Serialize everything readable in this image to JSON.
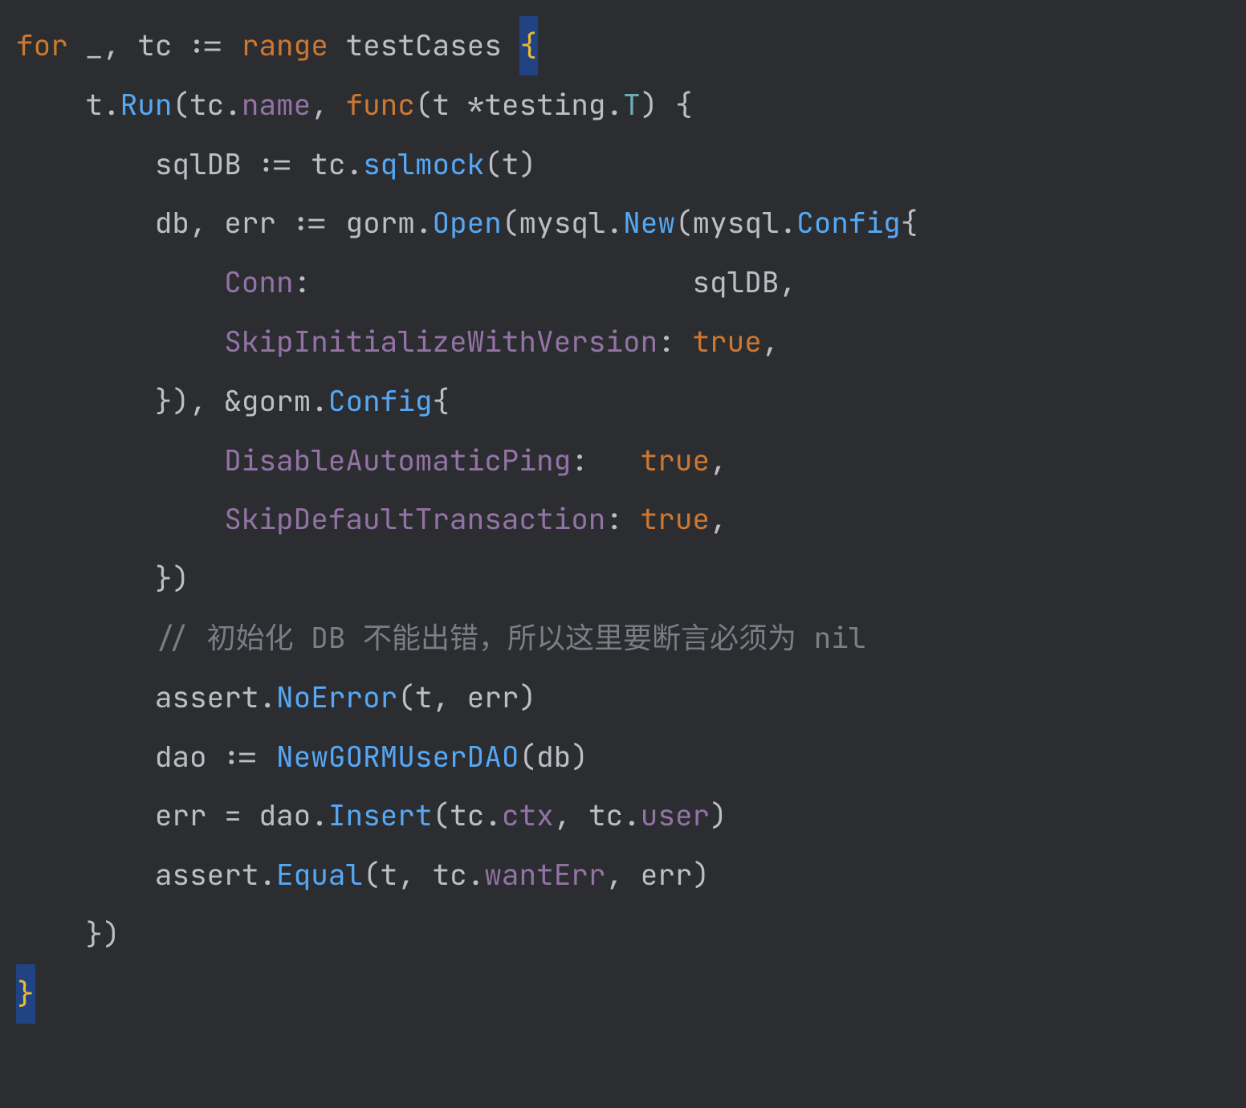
{
  "code": {
    "l1": {
      "kw_for": "for",
      "blank": "_",
      "tc": "tc",
      "assign": ":=",
      "kw_range": "range",
      "testCases": "testCases",
      "lbr": "{"
    },
    "l2": {
      "t": "t",
      "Run": "Run",
      "lp": "(",
      "tc": "tc",
      "dot": ".",
      "name": "name",
      "comma": ",",
      "kw_func": "func",
      "lp2": "(",
      "t2": "t",
      "star": "*",
      "testing": "testing",
      "dot2": ".",
      "T": "T",
      "rp": ")",
      "lbr": "{"
    },
    "l3": {
      "sqlDB": "sqlDB",
      "assign": ":=",
      "tc": "tc",
      "dot": ".",
      "sqlmock": "sqlmock",
      "lp": "(",
      "t": "t",
      "rp": ")"
    },
    "l4": {
      "db": "db",
      "comma": ",",
      "err": "err",
      "assign": ":=",
      "gorm": "gorm",
      "dot": ".",
      "Open": "Open",
      "lp": "(",
      "mysql": "mysql",
      "dot2": ".",
      "New": "New",
      "lp2": "(",
      "mysql2": "mysql",
      "dot3": ".",
      "Config": "Config",
      "lbr": "{"
    },
    "l5": {
      "Conn": "Conn",
      "colon": ":",
      "sqlDB": "sqlDB",
      "comma": ","
    },
    "l6": {
      "Skip": "SkipInitializeWithVersion",
      "colon": ":",
      "true": "true",
      "comma": ","
    },
    "l7": {
      "rbrace": "}",
      "rp": ")",
      "comma": ",",
      "amp": "&",
      "gorm": "gorm",
      "dot": ".",
      "Config": "Config",
      "lbr": "{"
    },
    "l8": {
      "DisableAutomaticPing": "DisableAutomaticPing",
      "colon": ":",
      "true": "true",
      "comma": ","
    },
    "l9": {
      "SkipDefaultTransaction": "SkipDefaultTransaction",
      "colon": ":",
      "true": "true",
      "comma": ","
    },
    "l10": {
      "rbrace": "}",
      "rp": ")"
    },
    "l11": {
      "comment": "// 初始化 DB 不能出错，所以这里要断言必须为 nil"
    },
    "l12": {
      "assert": "assert",
      "dot": ".",
      "NoError": "NoError",
      "lp": "(",
      "t": "t",
      "comma": ",",
      "err": "err",
      "rp": ")"
    },
    "l13": {
      "dao": "dao",
      "assign": ":=",
      "NewGORMUserDAO": "NewGORMUserDAO",
      "lp": "(",
      "db": "db",
      "rp": ")"
    },
    "l14": {
      "err": "err",
      "eq": "=",
      "dao": "dao",
      "dot": ".",
      "Insert": "Insert",
      "lp": "(",
      "tc": "tc",
      "dot2": ".",
      "ctx": "ctx",
      "comma": ",",
      "tc2": "tc",
      "dot3": ".",
      "user": "user",
      "rp": ")"
    },
    "l15": {
      "assert": "assert",
      "dot": ".",
      "Equal": "Equal",
      "lp": "(",
      "t": "t",
      "comma": ",",
      "tc": "tc",
      "dot2": ".",
      "wantErr": "wantErr",
      "comma2": ",",
      "err": "err",
      "rp": ")"
    },
    "l16": {
      "rbrace": "}",
      "rp": ")"
    },
    "l17": {
      "rbrace": "}"
    }
  }
}
